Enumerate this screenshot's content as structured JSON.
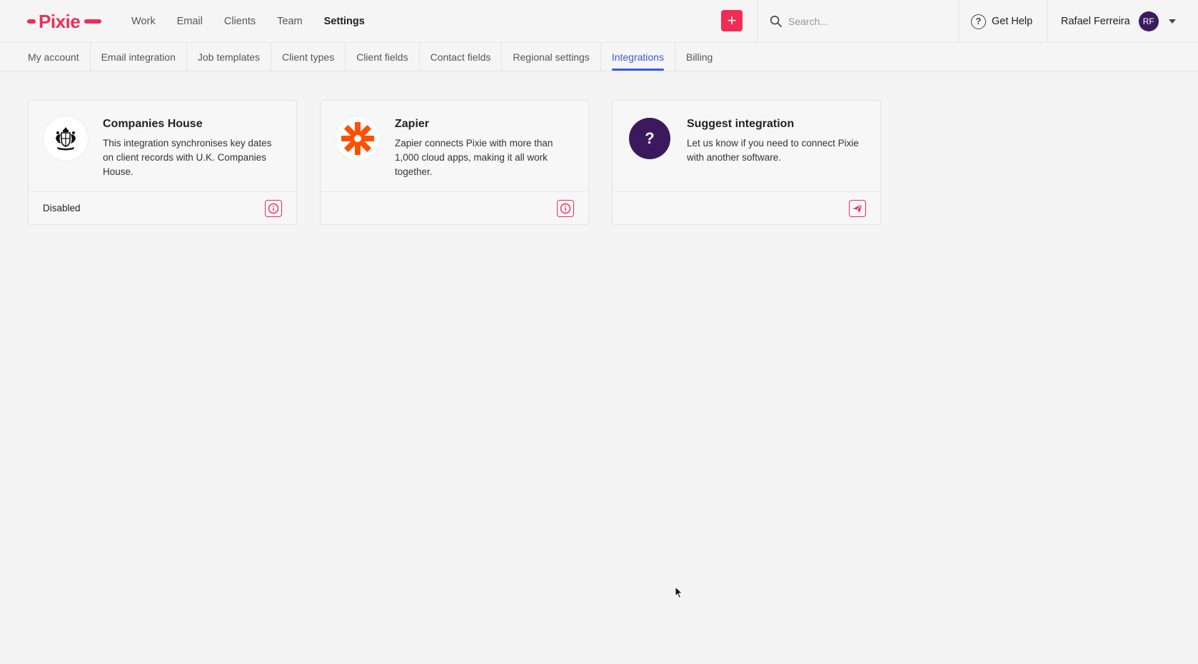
{
  "colors": {
    "accent": "#ef2d56",
    "active_tab": "#3b5bdb",
    "zapier": "#ff4f00",
    "suggest_bg": "#3a1a5c"
  },
  "app": {
    "logo_text": "Pixie"
  },
  "nav": {
    "items": [
      {
        "label": "Work"
      },
      {
        "label": "Email"
      },
      {
        "label": "Clients"
      },
      {
        "label": "Team"
      },
      {
        "label": "Settings",
        "active": true
      }
    ]
  },
  "header": {
    "add_label": "+",
    "search_placeholder": "Search...",
    "help_label": "Get Help",
    "user_name": "Rafael Ferreira",
    "user_initials": "RF"
  },
  "tabs": [
    {
      "label": "My account"
    },
    {
      "label": "Email integration"
    },
    {
      "label": "Job templates"
    },
    {
      "label": "Client types"
    },
    {
      "label": "Client fields"
    },
    {
      "label": "Contact fields"
    },
    {
      "label": "Regional settings"
    },
    {
      "label": "Integrations",
      "active": true
    },
    {
      "label": "Billing"
    }
  ],
  "cards": [
    {
      "title": "Companies House",
      "description": "This integration synchronises key dates on client records with U.K. Companies House.",
      "status": "Disabled",
      "icon": "royal-crest-icon",
      "action_icon": "info-icon"
    },
    {
      "title": "Zapier",
      "description": "Zapier connects Pixie with more than 1,000 cloud apps, making it all work together.",
      "status": "",
      "icon": "zapier-asterisk-icon",
      "action_icon": "info-icon"
    },
    {
      "title": "Suggest integration",
      "description": "Let us know if you need to connect Pixie with another software.",
      "status": "",
      "icon": "question-mark-icon",
      "icon_glyph": "?",
      "action_icon": "send-icon"
    }
  ]
}
